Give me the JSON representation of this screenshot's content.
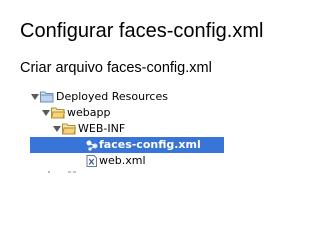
{
  "slide": {
    "title": "Configurar faces-config.xml",
    "subtitle": "Criar arquivo faces-config.xml"
  },
  "tree": {
    "selection_color": "#3875d7",
    "items": [
      {
        "label": "Deployed Resources",
        "icon": "folder-icon",
        "expanded": true
      },
      {
        "label": "webapp",
        "icon": "folder-icon",
        "expanded": true
      },
      {
        "label": "WEB-INF",
        "icon": "folder-icon",
        "expanded": true
      },
      {
        "label": "faces-config.xml",
        "icon": "faces-config-icon",
        "selected": true
      },
      {
        "label": "web.xml",
        "icon": "xml-file-icon"
      }
    ]
  }
}
